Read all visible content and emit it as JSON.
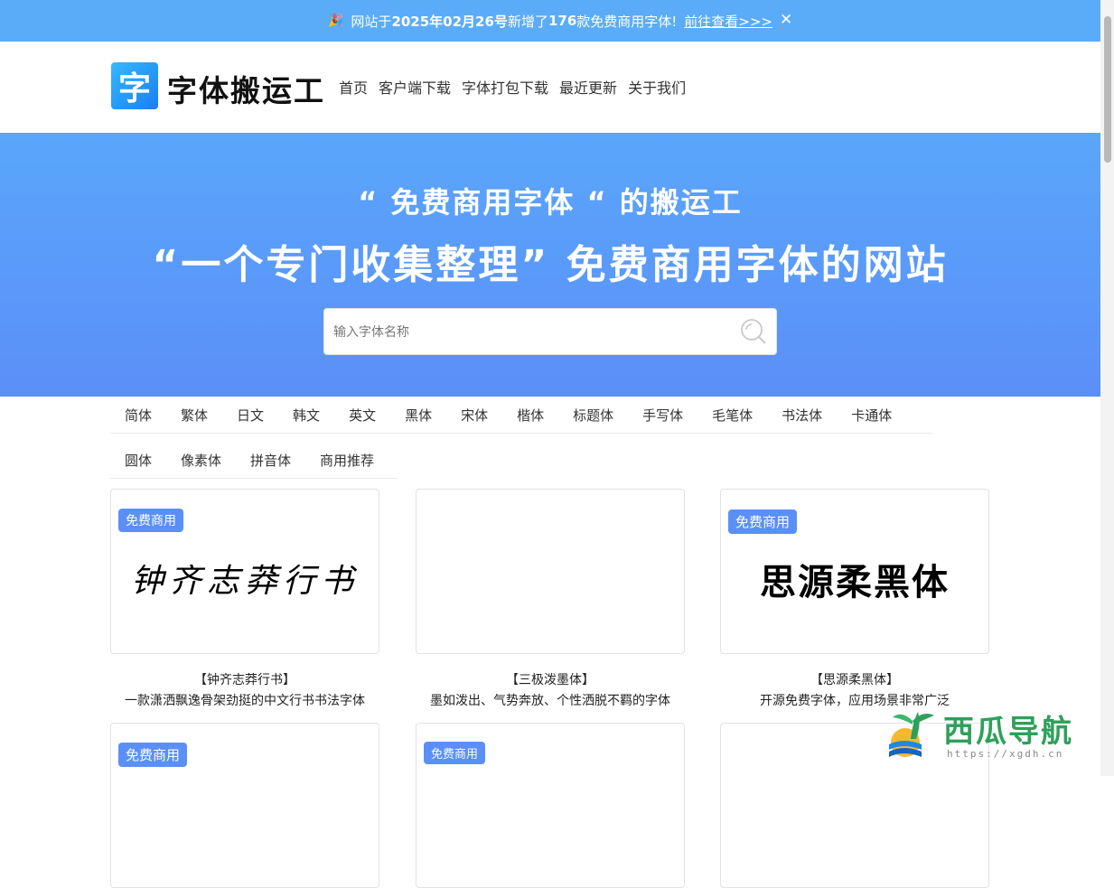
{
  "notice": {
    "prefix": "网站于 ",
    "date": "2025年02月26号",
    "middle": " 新增了 ",
    "count": "176",
    "suffix": " 款免费商用字体!",
    "link": "前往查看>>>",
    "close": "✕"
  },
  "header": {
    "logo_char": "字",
    "site_name": "字体搬运工",
    "nav": [
      "首页",
      "客户端下载",
      "字体打包下载",
      "最近更新",
      "关于我们"
    ]
  },
  "hero": {
    "slogan1": "“ 免费商用字体 “ 的搬运工",
    "slogan2": "“一个专门收集整理” 免费商用字体的网站",
    "search_placeholder": "输入字体名称"
  },
  "categories": {
    "row1": [
      "简体",
      "繁体",
      "日文",
      "韩文",
      "英文",
      "黑体",
      "宋体",
      "楷体",
      "标题体",
      "手写体",
      "毛笔体",
      "书法体",
      "卡通体"
    ],
    "row2": [
      "圆体",
      "像素体",
      "拼音体",
      "商用推荐"
    ]
  },
  "cards": [
    {
      "badge": "免费商用",
      "preview": "钟齐志莽行书",
      "title": "【钟齐志莽行书】",
      "desc": "一款潇洒飘逸骨架劲挺的中文行书书法字体"
    },
    {
      "badge": "",
      "preview": "",
      "title": "【三极泼墨体】",
      "desc": "墨如泼出、气势奔放、个性洒脱不羁的字体"
    },
    {
      "badge": "免费商用",
      "preview": "思源柔黑体",
      "title": "【思源柔黑体】",
      "desc": "开源免费字体，应用场景非常广泛"
    },
    {
      "badge": "免费商用",
      "preview": "",
      "title": "",
      "desc": ""
    },
    {
      "badge": "免费商用",
      "preview": "",
      "title": "",
      "desc": ""
    },
    {
      "badge": "",
      "preview": "",
      "title": "",
      "desc": ""
    }
  ],
  "watermark": {
    "name": "西瓜导航",
    "url": "https://xgdh.cn"
  },
  "colors": {
    "notice_bg": "#5aacf8",
    "hero_top": "#5aa6fb",
    "hero_bottom": "#5b8ff8",
    "badge_bg": "#5b8ff8",
    "watermark_green": "#2ea05a"
  }
}
